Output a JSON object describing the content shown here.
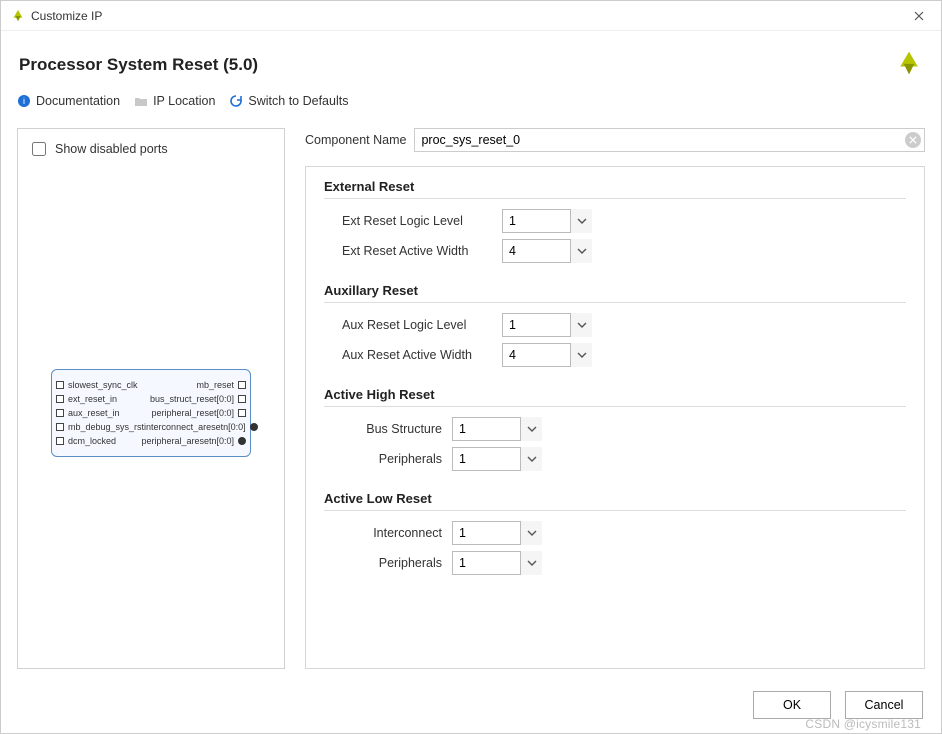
{
  "window": {
    "title": "Customize IP"
  },
  "header": {
    "title": "Processor System Reset (5.0)"
  },
  "toolbar": {
    "documentation": "Documentation",
    "ip_location": "IP Location",
    "switch_defaults": "Switch to Defaults"
  },
  "left": {
    "show_disabled_ports": "Show disabled ports",
    "ports_left": [
      "slowest_sync_clk",
      "ext_reset_in",
      "aux_reset_in",
      "mb_debug_sys_rst",
      "dcm_locked"
    ],
    "ports_right": [
      "mb_reset",
      "bus_struct_reset[0:0]",
      "peripheral_reset[0:0]",
      "interconnect_aresetn[0:0]",
      "peripheral_aresetn[0:0]"
    ]
  },
  "component_name": {
    "label": "Component Name",
    "value": "proc_sys_reset_0"
  },
  "sections": {
    "external_reset": {
      "title": "External Reset",
      "logic_level": {
        "label": "Ext Reset Logic Level",
        "value": "1"
      },
      "active_width": {
        "label": "Ext Reset Active Width",
        "value": "4"
      }
    },
    "aux_reset": {
      "title": "Auxillary Reset",
      "logic_level": {
        "label": "Aux Reset Logic Level",
        "value": "1"
      },
      "active_width": {
        "label": "Aux Reset Active Width",
        "value": "4"
      }
    },
    "active_high": {
      "title": "Active High Reset",
      "bus_structure": {
        "label": "Bus Structure",
        "value": "1"
      },
      "peripherals": {
        "label": "Peripherals",
        "value": "1"
      }
    },
    "active_low": {
      "title": "Active Low Reset",
      "interconnect": {
        "label": "Interconnect",
        "value": "1"
      },
      "peripherals": {
        "label": "Peripherals",
        "value": "1"
      }
    }
  },
  "footer": {
    "ok": "OK",
    "cancel": "Cancel"
  },
  "watermark": "CSDN @icysmile131"
}
